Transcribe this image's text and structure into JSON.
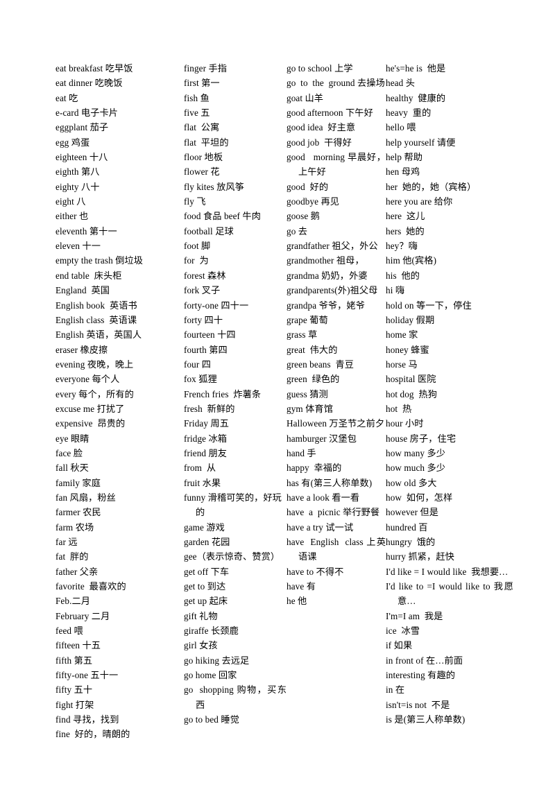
{
  "document": {
    "type": "vocabulary-glossary",
    "language_pair": "English-Chinese",
    "page_background": "#ffffff",
    "text_color": "#000000"
  },
  "columns": [
    {
      "id": "column-1",
      "entries": [
        "eat breakfast 吃早饭",
        "eat dinner 吃晚饭",
        "eat 吃",
        "e-card 电子卡片",
        "eggplant 茄子",
        "egg 鸡蛋",
        "eighteen 十八",
        "eighth 第八",
        "eighty 八十",
        "eight 八",
        "either 也",
        "eleventh 第十一",
        "eleven 十一",
        "empty the trash 倒垃圾",
        "end table  床头柜",
        "England  英国",
        "English book  英语书",
        "English class  英语课",
        "English 英语，英国人",
        "eraser 橡皮擦",
        "evening 夜晚，晚上",
        "everyone 每个人",
        "every 每个，所有的",
        "excuse me 打扰了",
        "expensive  昂贵的",
        "eye 眼睛",
        "face 脸",
        "fall 秋天",
        "family 家庭",
        "fan 风扇，粉丝",
        "farmer 农民",
        "farm 农场",
        "far 远",
        "fat  胖的",
        "father 父亲",
        "favorite  最喜欢的",
        "Feb.二月",
        "February 二月",
        "feed 喂",
        "fifteen 十五",
        "fifth 第五",
        "fifty-one 五十一",
        "fifty 五十",
        "fight 打架",
        "find 寻找，找到",
        "fine  好的，晴朗的"
      ]
    },
    {
      "id": "column-2",
      "entries": [
        "finger 手指",
        "first 第一",
        "fish 鱼",
        "five 五",
        "flat  公寓",
        "flat  平坦的",
        "floor 地板",
        "flower 花",
        "fly kites 放风筝",
        "fly 飞",
        "food 食品 beef 牛肉",
        "football 足球",
        "foot 脚",
        "for  为",
        "forest 森林",
        "fork 叉子",
        "forty-one 四十一",
        "forty 四十",
        "fourteen 十四",
        "fourth 第四",
        "four 四",
        "fox 狐狸",
        "French fries  炸薯条",
        "fresh  新鲜的",
        "Friday 周五",
        "fridge 冰箱",
        "friend 朋友",
        "from  从",
        "fruit 水果",
        "funny 滑稽可笑的，好玩的",
        "game 游戏",
        "garden 花园",
        "gee（表示惊奇、赞赏）",
        "get off 下车",
        "get to 到达",
        "get up 起床",
        "gift 礼物",
        "giraffe 长颈鹿",
        "girl 女孩",
        "go hiking 去远足",
        "go home 回家",
        "go  shopping 购物，买东西",
        "go to bed 睡觉"
      ]
    },
    {
      "id": "column-3",
      "entries": [
        "go to school 上学",
        "go  to  the  ground 去操场",
        "goat 山羊",
        "good afternoon 下午好",
        "good idea  好主意",
        "good job  干得好",
        "good   morning 早晨好，上午好",
        "good  好的",
        "goodbye 再见",
        "goose 鹅",
        "go 去",
        "grandfather 祖父，外公",
        "grandmother 祖母，",
        "grandma 奶奶，外婆",
        "grandparents(外)祖父母",
        "grandpa 爷爷，姥爷",
        "grape 葡萄",
        "grass 草",
        "great  伟大的",
        "green beans  青豆",
        "green  绿色的",
        "guess 猜测",
        "gym 体育馆",
        "Halloween 万圣节之前夕",
        "hamburger 汉堡包",
        "hand 手",
        "happy  幸福的",
        "has 有(第三人称单数)",
        "have a look 看一看",
        "have  a  picnic 举行野餐",
        "have a try 试一试",
        "have  English  class 上英语课",
        "have to 不得不",
        "have 有",
        "he 他"
      ]
    },
    {
      "id": "column-4",
      "entries": [
        "he's=he is  他是",
        "head 头",
        "healthy  健康的",
        "heavy  重的",
        "hello 喂",
        "help yourself 请便",
        "help 帮助",
        "hen 母鸡",
        "her  她的，她（宾格）",
        "here you are 给你",
        "here  这儿",
        "hers  她的",
        "hey？嗨",
        "him 他(宾格)",
        "his  他的",
        "hi 嗨",
        "hold on 等一下，停住",
        "holiday 假期",
        "home 家",
        "honey 蜂蜜",
        "horse 马",
        "hospital 医院",
        "hot dog  热狗",
        "hot  热",
        "hour 小时",
        "house 房子，住宅",
        "how many 多少",
        "how much 多少",
        "how old 多大",
        "how  如何，怎样",
        "however 但是",
        "hundred 百",
        "hungry  饿的",
        "hurry 抓紧，赶快",
        "I'd like = I would like  我想要…",
        "I'd like to =I would like to 我愿意…",
        "I'm=I am  我是",
        "ice  冰雪",
        "if 如果",
        "in front of 在…前面",
        "interesting 有趣的",
        "in 在",
        "isn't=is not  不是",
        "is 是(第三人称单数)"
      ]
    }
  ]
}
